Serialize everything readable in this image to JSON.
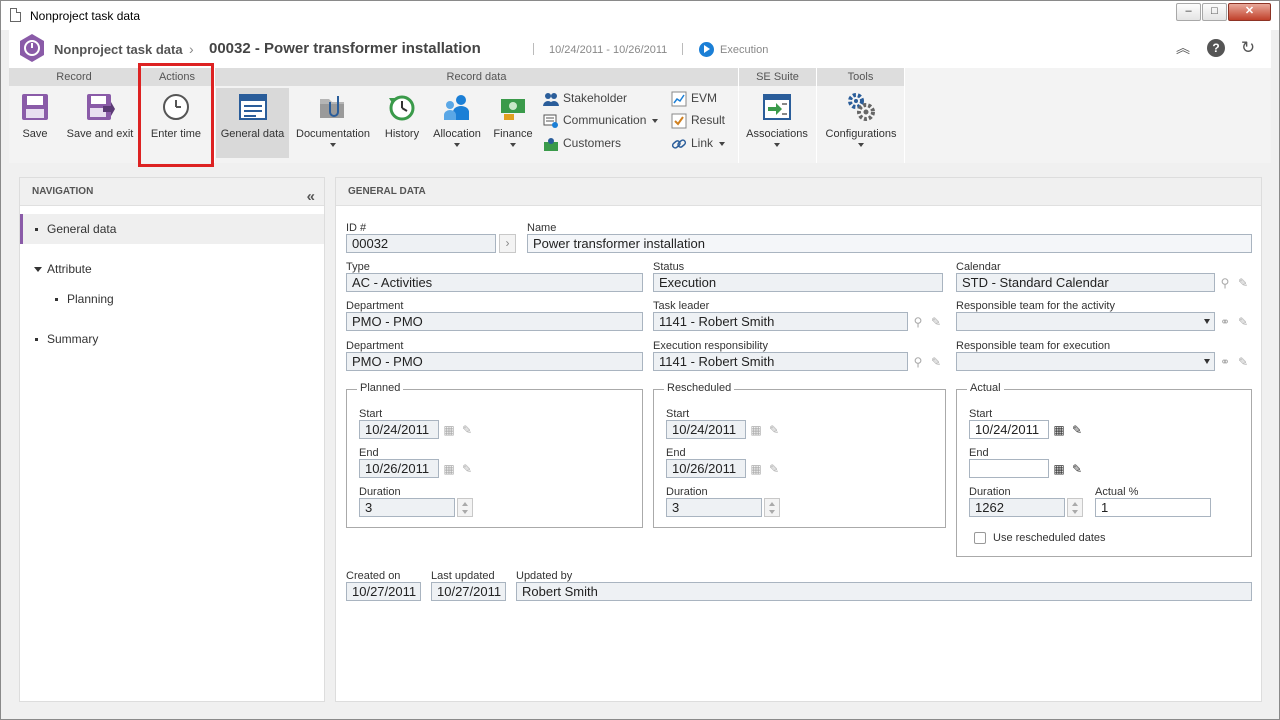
{
  "window": {
    "title": "Nonproject task data",
    "controls": {
      "minimize": "–",
      "maximize": "□",
      "close": "✕"
    }
  },
  "header": {
    "app_name": "Nonproject task data",
    "record_title": "00032 - Power transformer installation",
    "dates": "10/24/2011 - 10/26/2011",
    "status": "Execution",
    "icons": [
      "collapse-up-icon",
      "help-icon",
      "refresh-icon"
    ]
  },
  "ribbon": {
    "groups": {
      "record": "Record",
      "actions": "Actions",
      "record_data": "Record data",
      "se_suite": "SE Suite",
      "tools": "Tools"
    },
    "buttons": {
      "save": "Save",
      "save_exit": "Save and exit",
      "enter_time": "Enter time",
      "general_data": "General data",
      "documentation": "Documentation",
      "history": "History",
      "allocation": "Allocation",
      "finance": "Finance",
      "stakeholder": "Stakeholder",
      "communication": "Communication",
      "customers": "Customers",
      "evm": "EVM",
      "result": "Result",
      "link": "Link",
      "associations": "Associations",
      "configurations": "Configurations"
    }
  },
  "navigation": {
    "title": "NAVIGATION",
    "items": [
      {
        "label": "General data"
      },
      {
        "label": "Attribute"
      },
      {
        "label": "Planning"
      },
      {
        "label": "Summary"
      }
    ]
  },
  "general": {
    "title": "GENERAL DATA",
    "id_label": "ID #",
    "id_value": "00032",
    "name_label": "Name",
    "name_value": "Power transformer installation",
    "type_label": "Type",
    "type_value": "AC - Activities",
    "status_label": "Status",
    "status_value": "Execution",
    "calendar_label": "Calendar",
    "calendar_value": "STD - Standard Calendar",
    "dept1_label": "Department",
    "dept1_value": "PMO - PMO",
    "task_leader_label": "Task leader",
    "task_leader_value": "1141 - Robert Smith",
    "resp_team_activity_label": "Responsible team for the activity",
    "resp_team_activity_value": "",
    "dept2_label": "Department",
    "dept2_value": "PMO - PMO",
    "exec_resp_label": "Execution responsibility",
    "exec_resp_value": "1141 - Robert Smith",
    "resp_team_exec_label": "Responsible team for execution",
    "resp_team_exec_value": "",
    "planned": {
      "legend": "Planned",
      "start_label": "Start",
      "start": "10/24/2011",
      "end_label": "End",
      "end": "10/26/2011",
      "duration_label": "Duration",
      "duration": "3"
    },
    "rescheduled": {
      "legend": "Rescheduled",
      "start_label": "Start",
      "start": "10/24/2011",
      "end_label": "End",
      "end": "10/26/2011",
      "duration_label": "Duration",
      "duration": "3"
    },
    "actual": {
      "legend": "Actual",
      "start_label": "Start",
      "start": "10/24/2011",
      "end_label": "End",
      "end": "",
      "duration_label": "Duration",
      "duration": "1262",
      "pct_label": "Actual %",
      "pct": "1",
      "use_resched_label": "Use rescheduled dates",
      "use_resched_checked": false
    },
    "created_label": "Created on",
    "created_value": "10/27/2011",
    "updated_label": "Last updated",
    "updated_value": "10/27/2011",
    "updated_by_label": "Updated by",
    "updated_by_value": "Robert Smith"
  },
  "colors": {
    "accent": "#8a5ba8",
    "highlight": "#dd2222",
    "status_blue": "#1b7fd6"
  }
}
